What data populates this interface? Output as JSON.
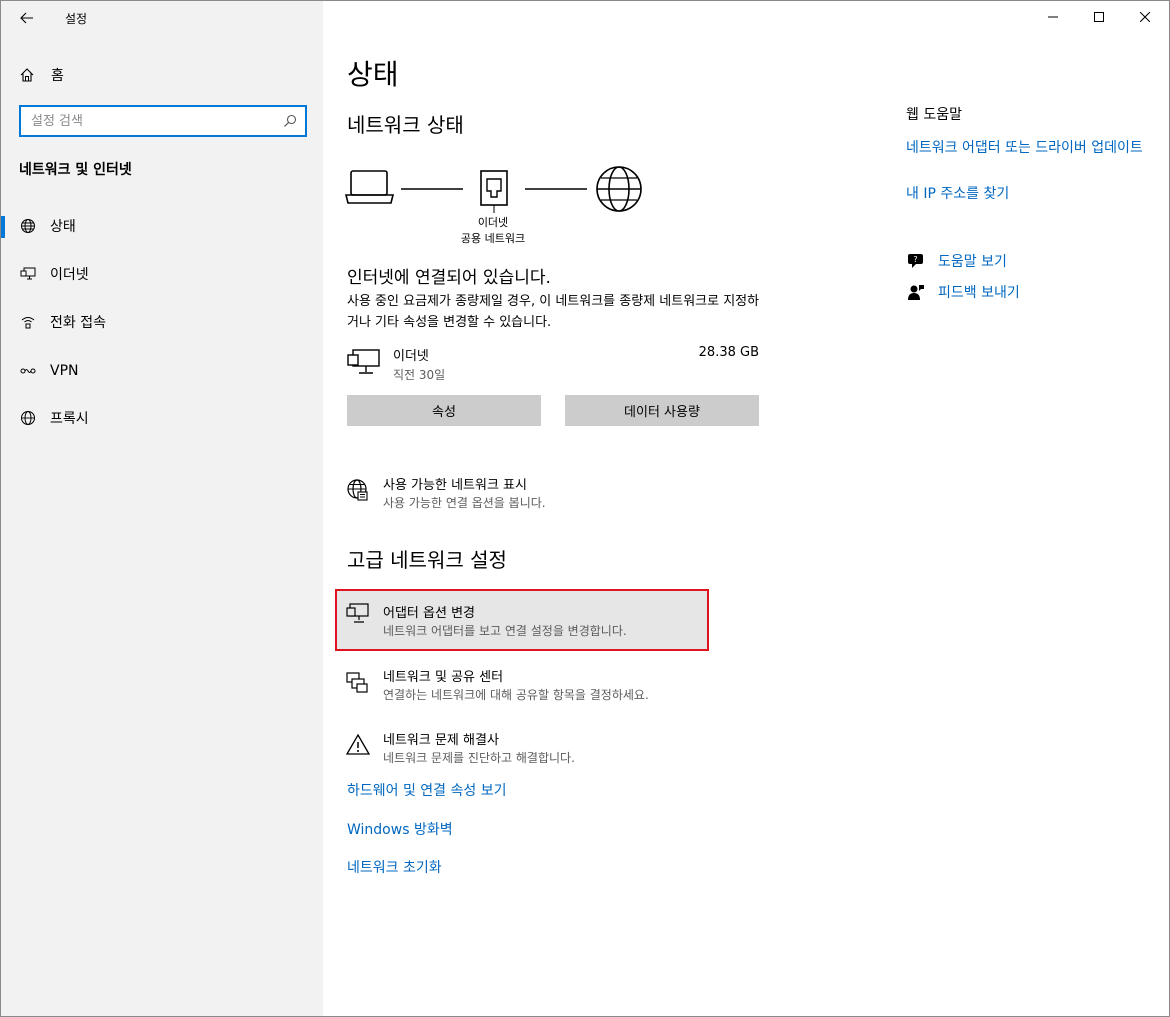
{
  "titlebar": {
    "app_title": "설정"
  },
  "sidebar": {
    "home_label": "홈",
    "search_placeholder": "설정 검색",
    "section_title": "네트워크 및 인터넷",
    "items": [
      {
        "label": "상태",
        "icon": "globe-status-icon"
      },
      {
        "label": "이더넷",
        "icon": "ethernet-icon"
      },
      {
        "label": "전화 접속",
        "icon": "dialup-icon"
      },
      {
        "label": "VPN",
        "icon": "vpn-icon"
      },
      {
        "label": "프록시",
        "icon": "globe-icon"
      }
    ]
  },
  "main": {
    "title": "상태",
    "network_status_heading": "네트워크 상태",
    "diagram": {
      "label_line1": "이더넷",
      "label_line2": "공용 네트워크"
    },
    "connected_title": "인터넷에 연결되어 있습니다.",
    "connected_desc": "사용 중인 요금제가 종량제일 경우, 이 네트워크를 종량제 네트워크로 지정하거나 기타 속성을 변경할 수 있습니다.",
    "adapter": {
      "name": "이더넷",
      "sub": "직전 30일",
      "usage": "28.38 GB"
    },
    "buttons": {
      "properties": "속성",
      "data_usage": "데이터 사용량"
    },
    "show_networks": {
      "title": "사용 가능한 네트워크 표시",
      "sub": "사용 가능한 연결 옵션을 봅니다."
    },
    "advanced_heading": "고급 네트워크 설정",
    "advanced_items": [
      {
        "title": "어댑터 옵션 변경",
        "sub": "네트워크 어댑터를 보고 연결 설정을 변경합니다."
      },
      {
        "title": "네트워크 및 공유 센터",
        "sub": "연결하는 네트워크에 대해 공유할 항목을 결정하세요."
      },
      {
        "title": "네트워크 문제 해결사",
        "sub": "네트워크 문제를 진단하고 해결합니다."
      }
    ],
    "links": {
      "hardware": "하드웨어 및 연결 속성 보기",
      "firewall": "Windows 방화벽",
      "reset": "네트워크 초기화"
    }
  },
  "right_panel": {
    "title": "웹 도움말",
    "link1": "네트워크 어댑터 또는 드라이버 업데이트",
    "link2": "내 IP 주소를 찾기",
    "get_help": "도움말 보기",
    "feedback": "피드백 보내기"
  },
  "colors": {
    "accent": "#0078d7",
    "link": "#0067c0",
    "highlight_border": "#e0141e",
    "sidebar_bg": "#f2f2f2",
    "button_bg": "#cccccc"
  }
}
